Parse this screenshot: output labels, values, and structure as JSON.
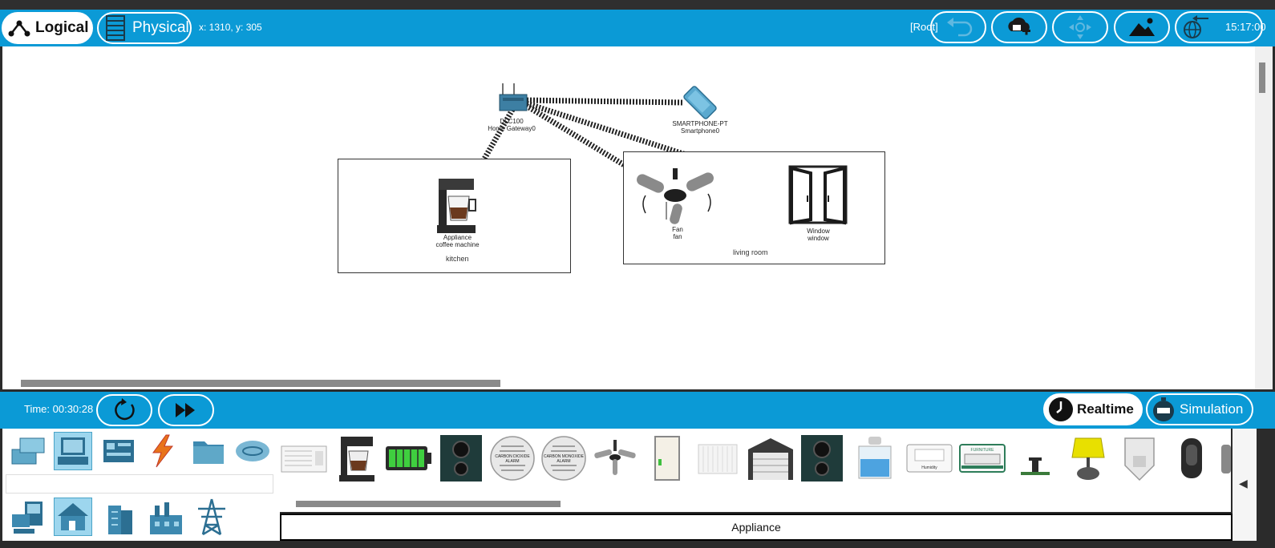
{
  "toolbar": {
    "logical_label": "Logical",
    "physical_label": "Physical",
    "coordinates": "x: 1310, y: 305",
    "root_label": "[Root]",
    "clock": "15:17:00"
  },
  "workspace": {
    "rooms": [
      {
        "label": "kitchen"
      },
      {
        "label": "living room"
      }
    ],
    "devices": {
      "gateway": {
        "model": "DLC100",
        "name": "Home Gateway0"
      },
      "smartphone": {
        "model": "SMARTPHONE-PT",
        "name": "Smartphone0"
      },
      "coffee": {
        "model": "Appliance",
        "name": "coffee machine"
      },
      "fan": {
        "model": "Fan",
        "name": "fan"
      },
      "window": {
        "model": "Window",
        "name": "window"
      }
    }
  },
  "bottom": {
    "time_label": "Time: 00:30:28",
    "realtime_label": "Realtime",
    "simulation_label": "Simulation"
  },
  "device_strip": {
    "selected_type": "Appliance",
    "items": [
      "air-conditioner",
      "coffee-machine",
      "battery",
      "speaker",
      "carbon-dioxide-alarm",
      "carbon-monoxide-alarm",
      "ceiling-fan",
      "door",
      "radiator",
      "garage-door",
      "speaker",
      "humidifier",
      "humidity-monitor",
      "furnace",
      "lawn-sprinkler",
      "lamp",
      "motion-detector",
      "webcam"
    ],
    "alarm_text": [
      "CARBON DIOXIDE ALARM",
      "CARBON MONOXIDE ALARM"
    ],
    "monitor_text": [
      "Humidity",
      "FURNITURE"
    ]
  },
  "colors": {
    "accent": "#0b9ad6",
    "selected_category": "#9dd6ee"
  }
}
